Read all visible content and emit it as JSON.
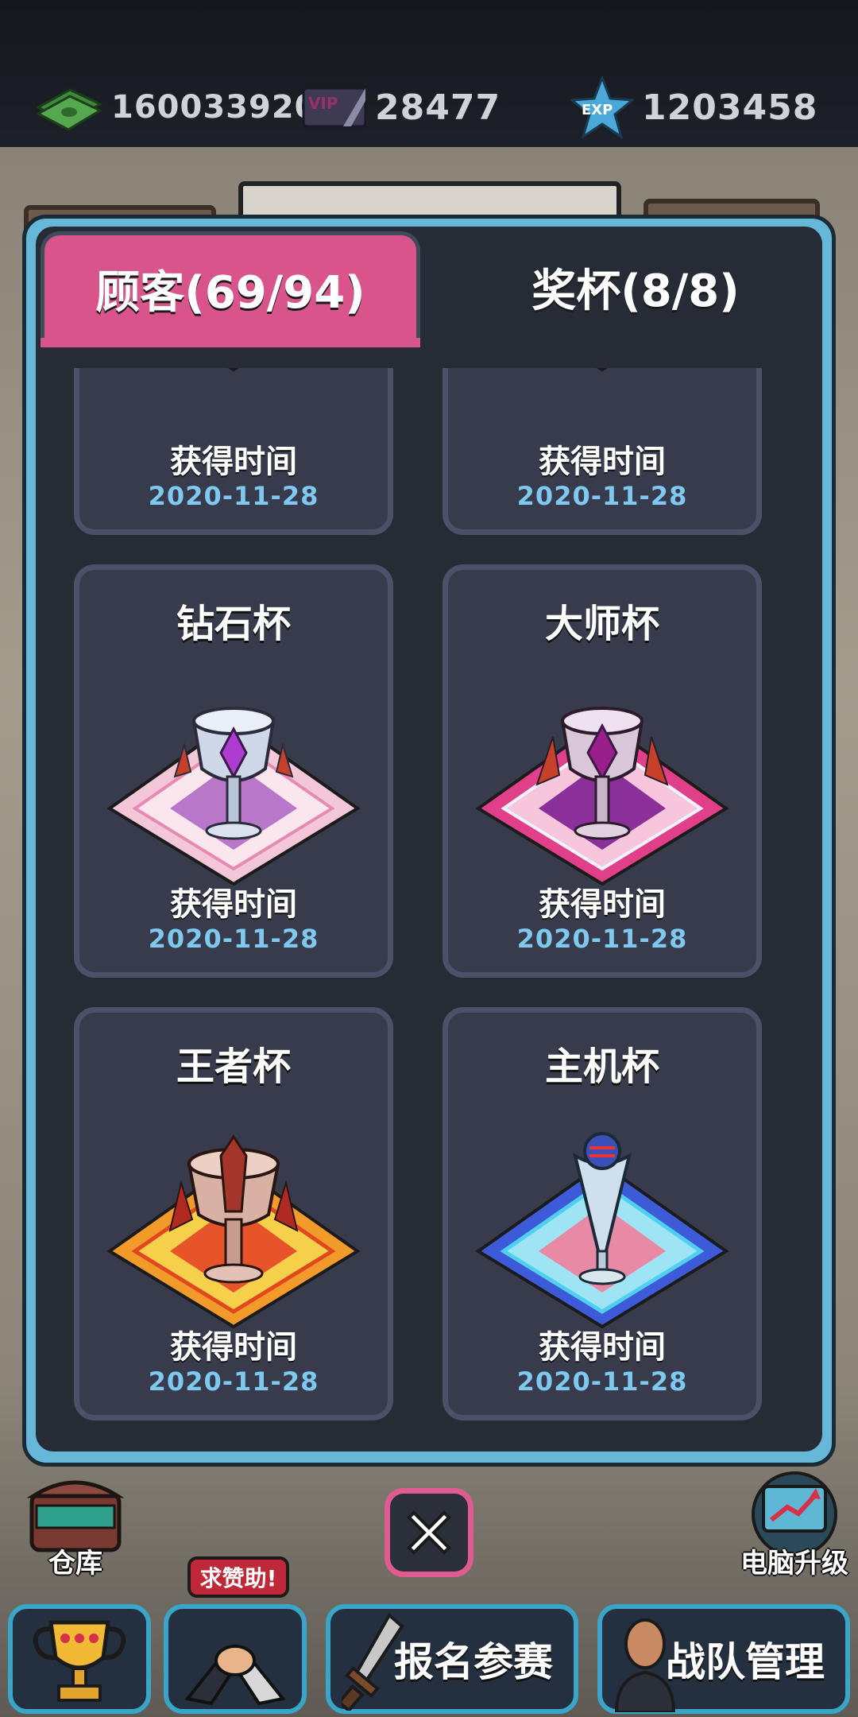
{
  "resources": {
    "cash": "160033920",
    "vip": "28477",
    "exp": "1203458",
    "vip_icon_text": "VIP",
    "exp_icon_text": "EXP"
  },
  "tabs": {
    "customers": "顾客(69/94)",
    "trophies": "奖杯(8/8)"
  },
  "cards": [
    {
      "name": "",
      "label": "获得时间",
      "date": "2020-11-28"
    },
    {
      "name": "",
      "label": "获得时间",
      "date": "2020-11-28"
    },
    {
      "name": "钻石杯",
      "label": "获得时间",
      "date": "2020-11-28"
    },
    {
      "name": "大师杯",
      "label": "获得时间",
      "date": "2020-11-28"
    },
    {
      "name": "王者杯",
      "label": "获得时间",
      "date": "2020-11-28"
    },
    {
      "name": "主机杯",
      "label": "获得时间",
      "date": "2020-11-28"
    }
  ],
  "side_buttons": {
    "warehouse": "仓库",
    "pc_upgrade": "电脑升级"
  },
  "bottom_bar": {
    "help_badge": "求赞助!",
    "register": "报名参赛",
    "team": "战队管理"
  },
  "colors": {
    "tab_inactive": "#d9548b",
    "modal_frame": "#66b7d8",
    "card_bg": "#373b4c",
    "date_text": "#7fc8f0"
  }
}
